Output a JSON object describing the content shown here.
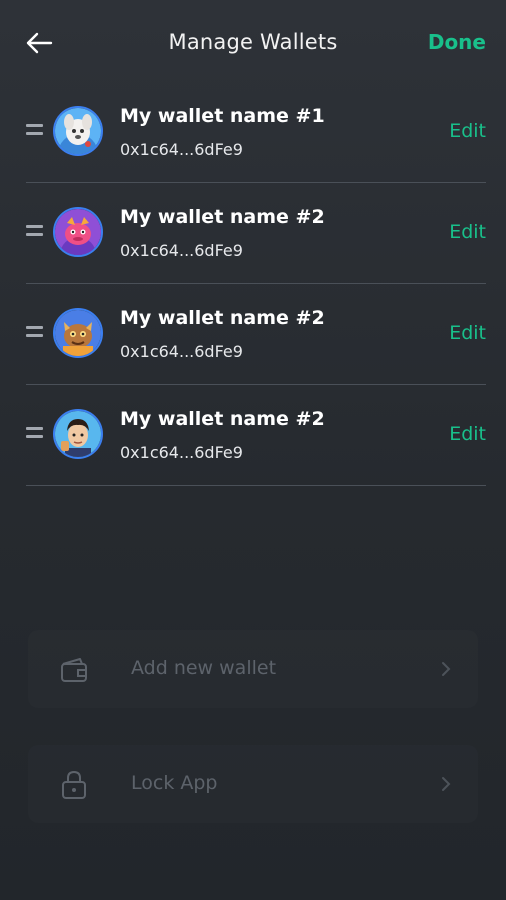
{
  "header": {
    "title": "Manage Wallets",
    "done_label": "Done"
  },
  "wallets": [
    {
      "name": "My wallet name #1",
      "address": "0x1c64...6dFe9",
      "edit_label": "Edit",
      "avatar": "white-dog-avatar"
    },
    {
      "name": "My wallet name #2",
      "address": "0x1c64...6dFe9",
      "edit_label": "Edit",
      "avatar": "pink-creature-avatar"
    },
    {
      "name": "My wallet name #2",
      "address": "0x1c64...6dFe9",
      "edit_label": "Edit",
      "avatar": "brown-monster-avatar"
    },
    {
      "name": "My wallet name #2",
      "address": "0x1c64...6dFe9",
      "edit_label": "Edit",
      "avatar": "man-character-avatar"
    }
  ],
  "actions": {
    "add_wallet": "Add new wallet",
    "lock_app": "Lock App"
  },
  "colors": {
    "accent": "#19c08b",
    "background": "#2a2e33",
    "muted": "#5d636b"
  }
}
